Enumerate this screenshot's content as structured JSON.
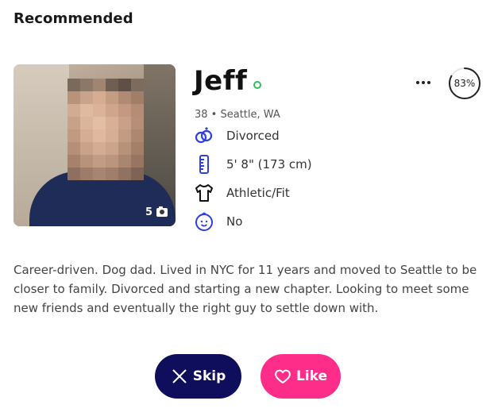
{
  "section": {
    "title": "Recommended"
  },
  "profile": {
    "name": "Jeff",
    "online": true,
    "meta": "38 • Seattle, WA",
    "photo_count": "5",
    "match_percent": "83%",
    "match_value": 0.83,
    "attributes": [
      {
        "icon": "rings-icon",
        "label": "Divorced"
      },
      {
        "icon": "ruler-icon",
        "label": "5' 8\" (173 cm)"
      },
      {
        "icon": "shirt-icon",
        "label": "Athletic/Fit"
      },
      {
        "icon": "baby-face-icon",
        "label": "No"
      }
    ],
    "bio": "Career-driven. Dog dad. Lived in NYC for 11 years and moved to Seattle to be closer to family. Divorced and starting a new chapter. Looking to meet some new friends and eventually the right guy to settle down with."
  },
  "actions": {
    "skip_label": "Skip",
    "like_label": "Like"
  },
  "colors": {
    "accent_blue": "#2d3fe0",
    "online_green": "#2fbf56",
    "skip_bg": "#0e0e5c",
    "like_bg": "#ff2d8a"
  }
}
